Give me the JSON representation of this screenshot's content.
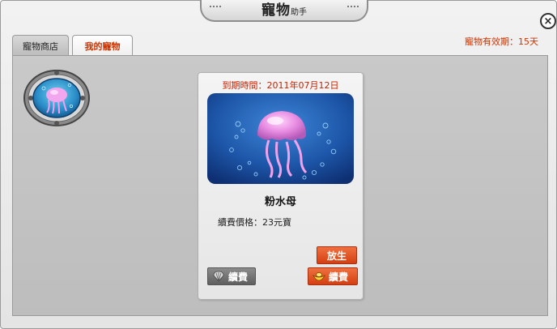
{
  "window": {
    "title": "寵物",
    "title_sub": "助手",
    "close_glyph": "×",
    "validity": "寵物有效期：15天"
  },
  "tabs": [
    {
      "label": "寵物商店",
      "active": false
    },
    {
      "label": "我的寵物",
      "active": true
    }
  ],
  "pet_card": {
    "expire": "到期時間：2011年07月12日",
    "name": "粉水母",
    "price": "續費價格：23元寶",
    "release_label": "放生",
    "renew_gray_label": "續費",
    "renew_orange_label": "續費"
  },
  "colors": {
    "accent_red": "#cc3300",
    "button_orange": "#e0531f",
    "jellyfish_pink": "#e48ce0",
    "ocean_blue": "#1a4e9e"
  },
  "icons": {
    "close": "close-icon",
    "porthole": "porthole-jellyfish-icon",
    "renew_gray": "shell-icon",
    "renew_orange": "ingot-icon"
  }
}
